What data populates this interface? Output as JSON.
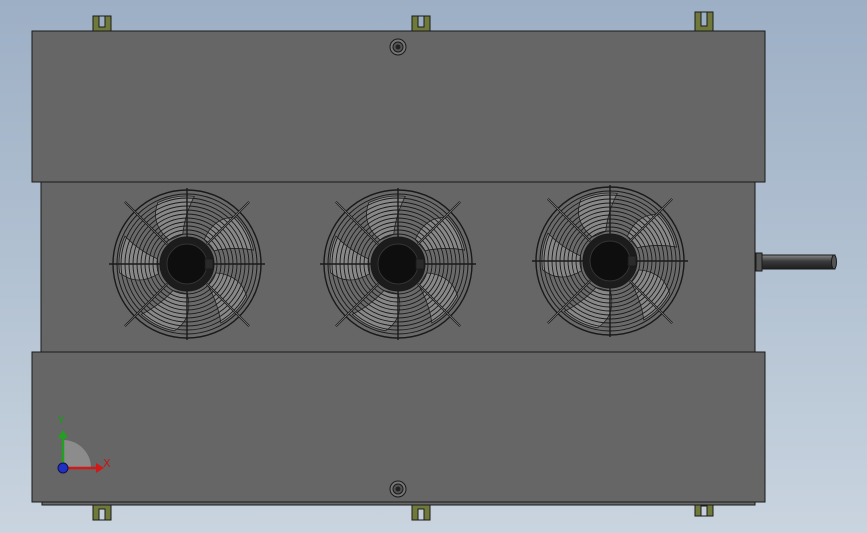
{
  "triad": {
    "x_label": "X",
    "y_label": "Y",
    "x_color": "#d01a1a",
    "y_color": "#22a022",
    "z_color": "#2030c0"
  },
  "model": {
    "panel_color": "#666666",
    "outline_color": "#1a1a1a",
    "fan_count": 3,
    "icons": [
      "fan-guard-icon",
      "mounting-bracket-icon",
      "bolt-hole-icon",
      "pipe-icon",
      "axis-triad-icon"
    ]
  }
}
